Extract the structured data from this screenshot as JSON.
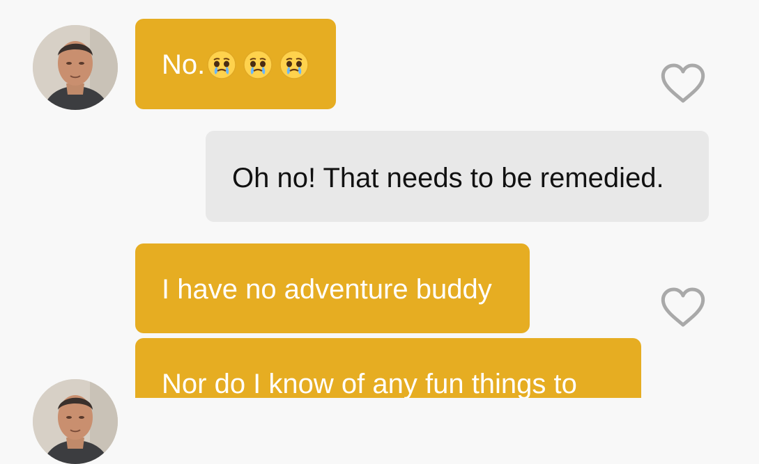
{
  "messages": [
    {
      "text": "No.",
      "emoji_count": 3,
      "emoji": "crying-face"
    },
    {
      "text": "Oh no! That needs to be remedied."
    },
    {
      "text": "I have no adventure buddy"
    },
    {
      "text": "Nor do I know of any fun things to"
    }
  ],
  "icons": {
    "avatar": "profile-photo",
    "like": "heart-outline-icon"
  },
  "colors": {
    "incoming_bubble": "#e6ad22",
    "outgoing_bubble": "#e8e8e8",
    "background": "#f8f8f8",
    "heart_outline": "#a9a9a9"
  }
}
